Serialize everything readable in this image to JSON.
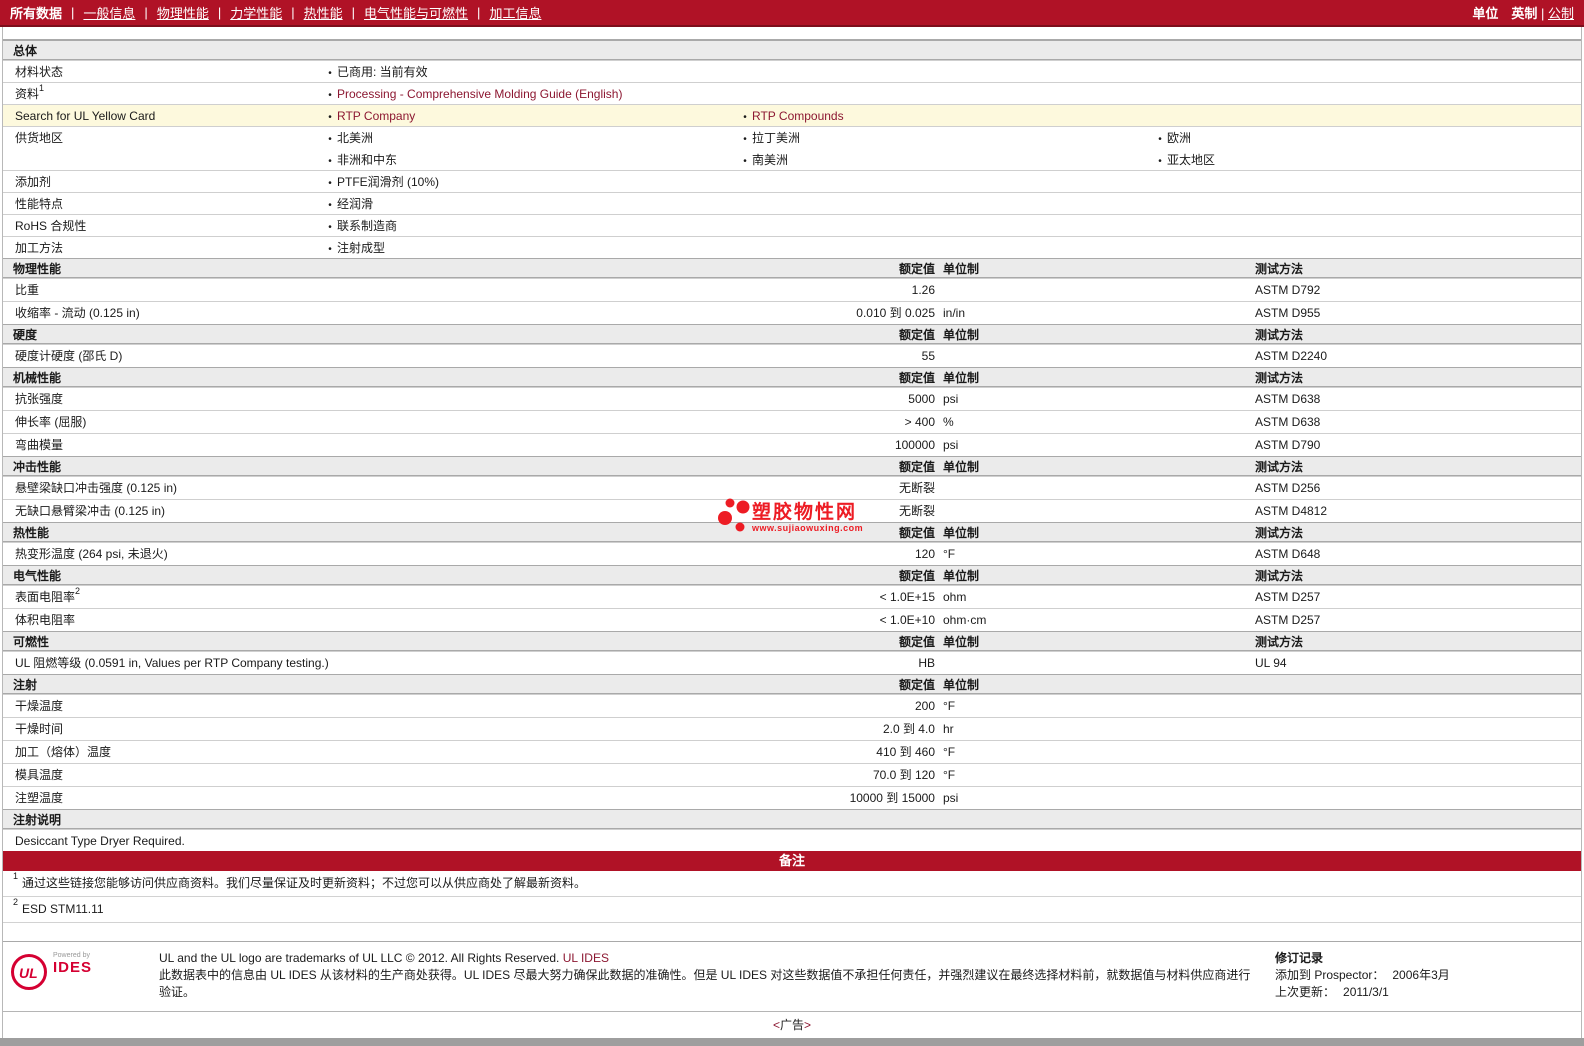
{
  "colors": {
    "accent_red": "#b01226",
    "link_maroon": "#8c1731",
    "highlight_yellow": "#fdf9dd",
    "watermark_red": "#ed1c24",
    "ul_logo_red": "#d50032"
  },
  "nav": {
    "items": [
      {
        "label": "所有数据",
        "current": true
      },
      {
        "label": "一般信息",
        "current": false
      },
      {
        "label": "物理性能",
        "current": false
      },
      {
        "label": "力学性能",
        "current": false
      },
      {
        "label": "热性能",
        "current": false
      },
      {
        "label": "电气性能与可燃性",
        "current": false
      },
      {
        "label": "加工信息",
        "current": false
      }
    ],
    "units_label": "单位",
    "unit_options": [
      {
        "label": "英制",
        "current": true
      },
      {
        "label": "公制",
        "current": false
      }
    ]
  },
  "table": {
    "sections": [
      {
        "title": "总体",
        "col_headers": null,
        "rows": [
          {
            "type": "bullets",
            "label": "材料状态",
            "sup": "",
            "highlight": false,
            "cols": [
              {
                "items": [
                  {
                    "text": "已商用: 当前有效",
                    "link": false
                  }
                ]
              },
              {
                "items": []
              },
              {
                "items": []
              }
            ]
          },
          {
            "type": "bullets",
            "label": "资料",
            "sup": "1",
            "highlight": false,
            "cols": [
              {
                "items": [
                  {
                    "text": "Processing - Comprehensive Molding Guide (English)",
                    "link": true
                  }
                ]
              },
              {
                "items": []
              },
              {
                "items": []
              }
            ]
          },
          {
            "type": "bullets",
            "label": "Search for UL Yellow Card",
            "sup": "",
            "highlight": true,
            "cols": [
              {
                "items": [
                  {
                    "text": "RTP Company",
                    "link": true
                  }
                ]
              },
              {
                "items": [
                  {
                    "text": "RTP Compounds",
                    "link": true
                  }
                ]
              },
              {
                "items": []
              }
            ]
          },
          {
            "type": "bullets",
            "label": "供货地区",
            "sup": "",
            "highlight": false,
            "cols": [
              {
                "items": [
                  {
                    "text": "北美洲",
                    "link": false
                  },
                  {
                    "text": "非洲和中东",
                    "link": false
                  }
                ]
              },
              {
                "items": [
                  {
                    "text": "拉丁美洲",
                    "link": false
                  },
                  {
                    "text": "南美洲",
                    "link": false
                  }
                ]
              },
              {
                "items": [
                  {
                    "text": "欧洲",
                    "link": false
                  },
                  {
                    "text": "亚太地区",
                    "link": false
                  }
                ]
              }
            ]
          },
          {
            "type": "bullets",
            "label": "添加剂",
            "sup": "",
            "highlight": false,
            "cols": [
              {
                "items": [
                  {
                    "text": "PTFE润滑剂  (10%)",
                    "link": false
                  }
                ]
              },
              {
                "items": []
              },
              {
                "items": []
              }
            ]
          },
          {
            "type": "bullets",
            "label": "性能特点",
            "sup": "",
            "highlight": false,
            "cols": [
              {
                "items": [
                  {
                    "text": "经润滑",
                    "link": false
                  }
                ]
              },
              {
                "items": []
              },
              {
                "items": []
              }
            ]
          },
          {
            "type": "bullets",
            "label": "RoHS 合规性",
            "sup": "",
            "highlight": false,
            "cols": [
              {
                "items": [
                  {
                    "text": "联系制造商",
                    "link": false
                  }
                ]
              },
              {
                "items": []
              },
              {
                "items": []
              }
            ]
          },
          {
            "type": "bullets",
            "label": "加工方法",
            "sup": "",
            "highlight": false,
            "cols": [
              {
                "items": [
                  {
                    "text": "注射成型",
                    "link": false
                  }
                ]
              },
              {
                "items": []
              },
              {
                "items": []
              }
            ]
          }
        ]
      },
      {
        "title": "物理性能",
        "col_headers": {
          "value": "额定值",
          "unit": "单位制",
          "method": "测试方法"
        },
        "rows": [
          {
            "type": "value",
            "label": "比重",
            "sup": "",
            "value": "1.26",
            "unit": "",
            "method": "ASTM D792"
          },
          {
            "type": "value",
            "label": "收缩率  - 流动  (0.125 in)",
            "sup": "",
            "value": "0.010 到  0.025",
            "unit": "in/in",
            "method": "ASTM D955"
          }
        ]
      },
      {
        "title": "硬度",
        "col_headers": {
          "value": "额定值",
          "unit": "单位制",
          "method": "测试方法"
        },
        "rows": [
          {
            "type": "value",
            "label": "硬度计硬度  (邵氏  D)",
            "sup": "",
            "value": "55",
            "unit": "",
            "method": "ASTM D2240"
          }
        ]
      },
      {
        "title": "机械性能",
        "col_headers": {
          "value": "额定值",
          "unit": "单位制",
          "method": "测试方法"
        },
        "rows": [
          {
            "type": "value",
            "label": "抗张强度",
            "sup": "",
            "value": "5000",
            "unit": "psi",
            "method": "ASTM D638"
          },
          {
            "type": "value",
            "label": "伸长率  (屈服)",
            "sup": "",
            "value": "> 400",
            "unit": "%",
            "method": "ASTM D638"
          },
          {
            "type": "value",
            "label": "弯曲模量",
            "sup": "",
            "value": "100000",
            "unit": "psi",
            "method": "ASTM D790"
          }
        ]
      },
      {
        "title": "冲击性能",
        "col_headers": {
          "value": "额定值",
          "unit": "单位制",
          "method": "测试方法"
        },
        "rows": [
          {
            "type": "value",
            "label": "悬壁梁缺口冲击强度  (0.125 in)",
            "sup": "",
            "value": "无断裂",
            "unit": "",
            "method": "ASTM D256"
          },
          {
            "type": "value",
            "label": "无缺口悬臂梁冲击  (0.125 in)",
            "sup": "",
            "value": "无断裂",
            "unit": "",
            "method": "ASTM D4812"
          }
        ]
      },
      {
        "title": "热性能",
        "col_headers": {
          "value": "额定值",
          "unit": "单位制",
          "method": "测试方法"
        },
        "rows": [
          {
            "type": "value",
            "label": "热变形温度  (264 psi, 未退火)",
            "sup": "",
            "value": "120",
            "unit": "°F",
            "method": "ASTM D648"
          }
        ]
      },
      {
        "title": "电气性能",
        "col_headers": {
          "value": "额定值",
          "unit": "单位制",
          "method": "测试方法"
        },
        "rows": [
          {
            "type": "value",
            "label": "表面电阻率",
            "sup": "2",
            "value": "< 1.0E+15",
            "unit": "ohm",
            "method": "ASTM D257"
          },
          {
            "type": "value",
            "label": "体积电阻率",
            "sup": "",
            "value": "< 1.0E+10",
            "unit": "ohm·cm",
            "method": "ASTM D257"
          }
        ]
      },
      {
        "title": "可燃性",
        "col_headers": {
          "value": "额定值",
          "unit": "单位制",
          "method": "测试方法"
        },
        "rows": [
          {
            "type": "value",
            "label": "UL 阻燃等级  (0.0591 in, Values per RTP Company testing.)",
            "sup": "",
            "value": "HB",
            "unit": "",
            "method": "UL 94"
          }
        ]
      },
      {
        "title": "注射",
        "col_headers": {
          "value": "额定值",
          "unit": "单位制",
          "method": ""
        },
        "rows": [
          {
            "type": "value",
            "label": "干燥温度",
            "sup": "",
            "value": "200",
            "unit": "°F",
            "method": ""
          },
          {
            "type": "value",
            "label": "干燥时间",
            "sup": "",
            "value": "2.0 到  4.0",
            "unit": "hr",
            "method": ""
          },
          {
            "type": "value",
            "label": "加工（熔体）温度",
            "sup": "",
            "value": "410 到  460",
            "unit": "°F",
            "method": ""
          },
          {
            "type": "value",
            "label": "模具温度",
            "sup": "",
            "value": "70.0 到  120",
            "unit": "°F",
            "method": ""
          },
          {
            "type": "value",
            "label": "注塑温度",
            "sup": "",
            "value": "10000 到  15000",
            "unit": "psi",
            "method": ""
          }
        ]
      },
      {
        "title": "注射说明",
        "col_headers": null,
        "rows": [
          {
            "type": "text",
            "text": "Desiccant Type Dryer Required."
          }
        ]
      }
    ]
  },
  "remarks": {
    "title": "备注",
    "footnotes": [
      {
        "marker": "1",
        "text": "通过这些链接您能够访问供应商资料。我们尽量保证及时更新资料；不过您可以从供应商处了解最新资料。"
      },
      {
        "marker": "2",
        "text": "ESD STM11.11"
      }
    ]
  },
  "footer": {
    "logo_text": "UL",
    "powered_by": "Powered by",
    "ides": "IDES",
    "en_line": "UL and the UL logo are trademarks of UL LLC © 2012. All Rights Reserved.",
    "en_line_link": "UL IDES",
    "cn_line": "此数据表中的信息由  UL IDES 从该材料的生产商处获得。UL IDES 尽最大努力确保此数据的准确性。但是  UL IDES 对这些数据值不承担任何责任，并强烈建议在最终选择材料前，就数据值与材料供应商进行验证。",
    "revision": {
      "title": "修订记录",
      "rows": [
        {
          "label": "添加到  Prospector：",
          "value": "2006年3月"
        },
        {
          "label": "上次更新：",
          "value": "2011/3/1"
        }
      ]
    }
  },
  "ad": {
    "open": "<",
    "label": "广告",
    "close": ">"
  },
  "watermark": {
    "title": "塑胶物性网",
    "url": "www.sujiaowuxing.com"
  }
}
